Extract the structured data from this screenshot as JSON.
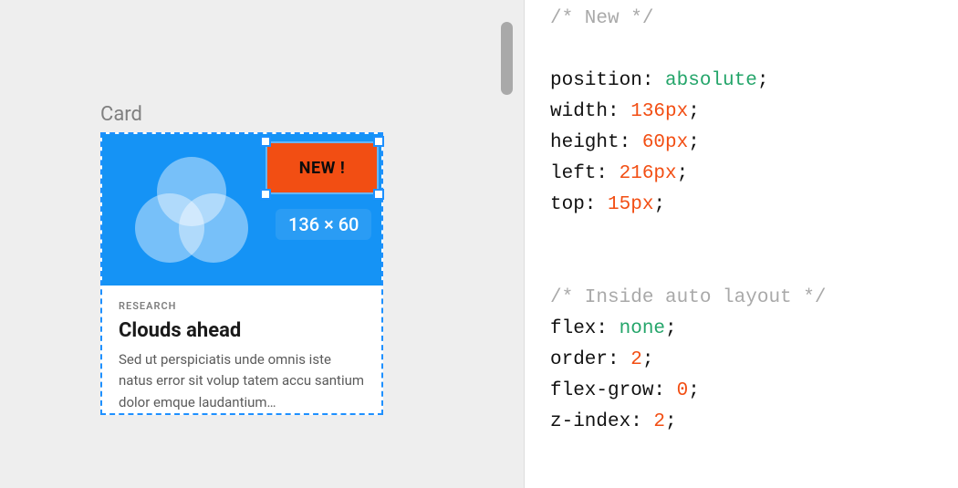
{
  "canvas": {
    "frame_name": "Card",
    "card": {
      "badge_text": "NEW !",
      "dimensions_label": "136 × 60",
      "eyebrow": "RESEARCH",
      "title": "Clouds ahead",
      "description": "Sed ut perspiciatis unde omnis iste natus error sit volup tatem accu santium dolor emque laudantium…"
    }
  },
  "code": {
    "comment_top": "/* New */",
    "lines": {
      "position_prop": "position: ",
      "position_val": "absolute",
      "width_prop": "width: ",
      "width_val": "136px",
      "height_prop": "height: ",
      "height_val": "60px",
      "left_prop": "left: ",
      "left_val": "216px",
      "top_prop": "top: ",
      "top_val": "15px"
    },
    "comment_mid": "/* Inside auto layout */",
    "lines2": {
      "flex_prop": "flex: ",
      "flex_val": "none",
      "order_prop": "order: ",
      "order_val": "2",
      "grow_prop": "flex-grow: ",
      "grow_val": "0",
      "z_prop": "z-index: ",
      "z_val": "2"
    }
  }
}
